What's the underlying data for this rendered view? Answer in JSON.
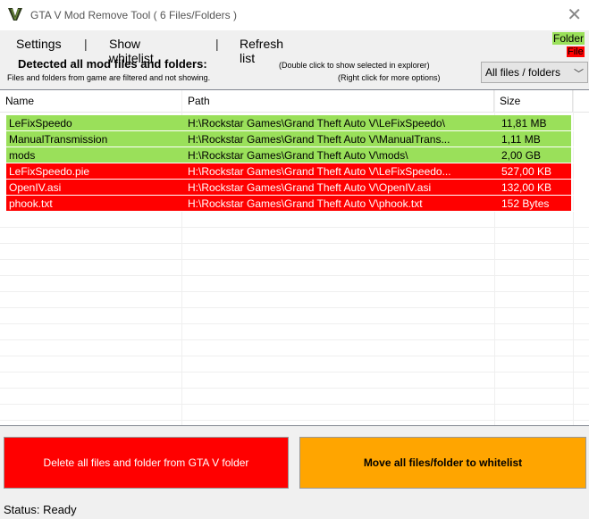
{
  "window": {
    "title": "GTA V Mod Remove Tool ( 6 Files/Folders )"
  },
  "menu": {
    "settings": "Settings",
    "show_whitelist": "Show whitelist",
    "refresh_list": "Refresh list",
    "separator": "|"
  },
  "legend": {
    "folder": "Folder",
    "file": "File",
    "folder_color": "#9ae05a",
    "file_color": "#ff0000"
  },
  "info": {
    "detected": "Detected all mod files and folders:",
    "filtered": "Files and folders from game are filtered and not showing.",
    "hint_double": "(Double click to show selected in explorer)",
    "hint_right": "(Right click for more options)"
  },
  "filter": {
    "selected": "All files / folders"
  },
  "list": {
    "columns": {
      "name": "Name",
      "path": "Path",
      "size": "Size"
    },
    "rows": [
      {
        "name": "LeFixSpeedo",
        "path": "H:\\Rockstar Games\\Grand Theft Auto V\\LeFixSpeedo\\",
        "size": "11,81 MB",
        "type": "folder"
      },
      {
        "name": "ManualTransmission",
        "path": "H:\\Rockstar Games\\Grand Theft Auto V\\ManualTrans...",
        "size": "1,11 MB",
        "type": "folder"
      },
      {
        "name": "mods",
        "path": "H:\\Rockstar Games\\Grand Theft Auto V\\mods\\",
        "size": "2,00 GB",
        "type": "folder"
      },
      {
        "name": "LeFixSpeedo.pie",
        "path": "H:\\Rockstar Games\\Grand Theft Auto V\\LeFixSpeedo...",
        "size": "527,00 KB",
        "type": "file"
      },
      {
        "name": "OpenIV.asi",
        "path": "H:\\Rockstar Games\\Grand Theft Auto V\\OpenIV.asi",
        "size": "132,00 KB",
        "type": "file"
      },
      {
        "name": "phook.txt",
        "path": "H:\\Rockstar Games\\Grand Theft Auto V\\phook.txt",
        "size": "152 Bytes",
        "type": "file"
      }
    ]
  },
  "buttons": {
    "delete": "Delete all files and folder from GTA V folder",
    "move": "Move all files/folder to whitelist",
    "delete_color": "#ff0000",
    "move_color": "#ffa500"
  },
  "status": {
    "text": "Status: Ready"
  }
}
